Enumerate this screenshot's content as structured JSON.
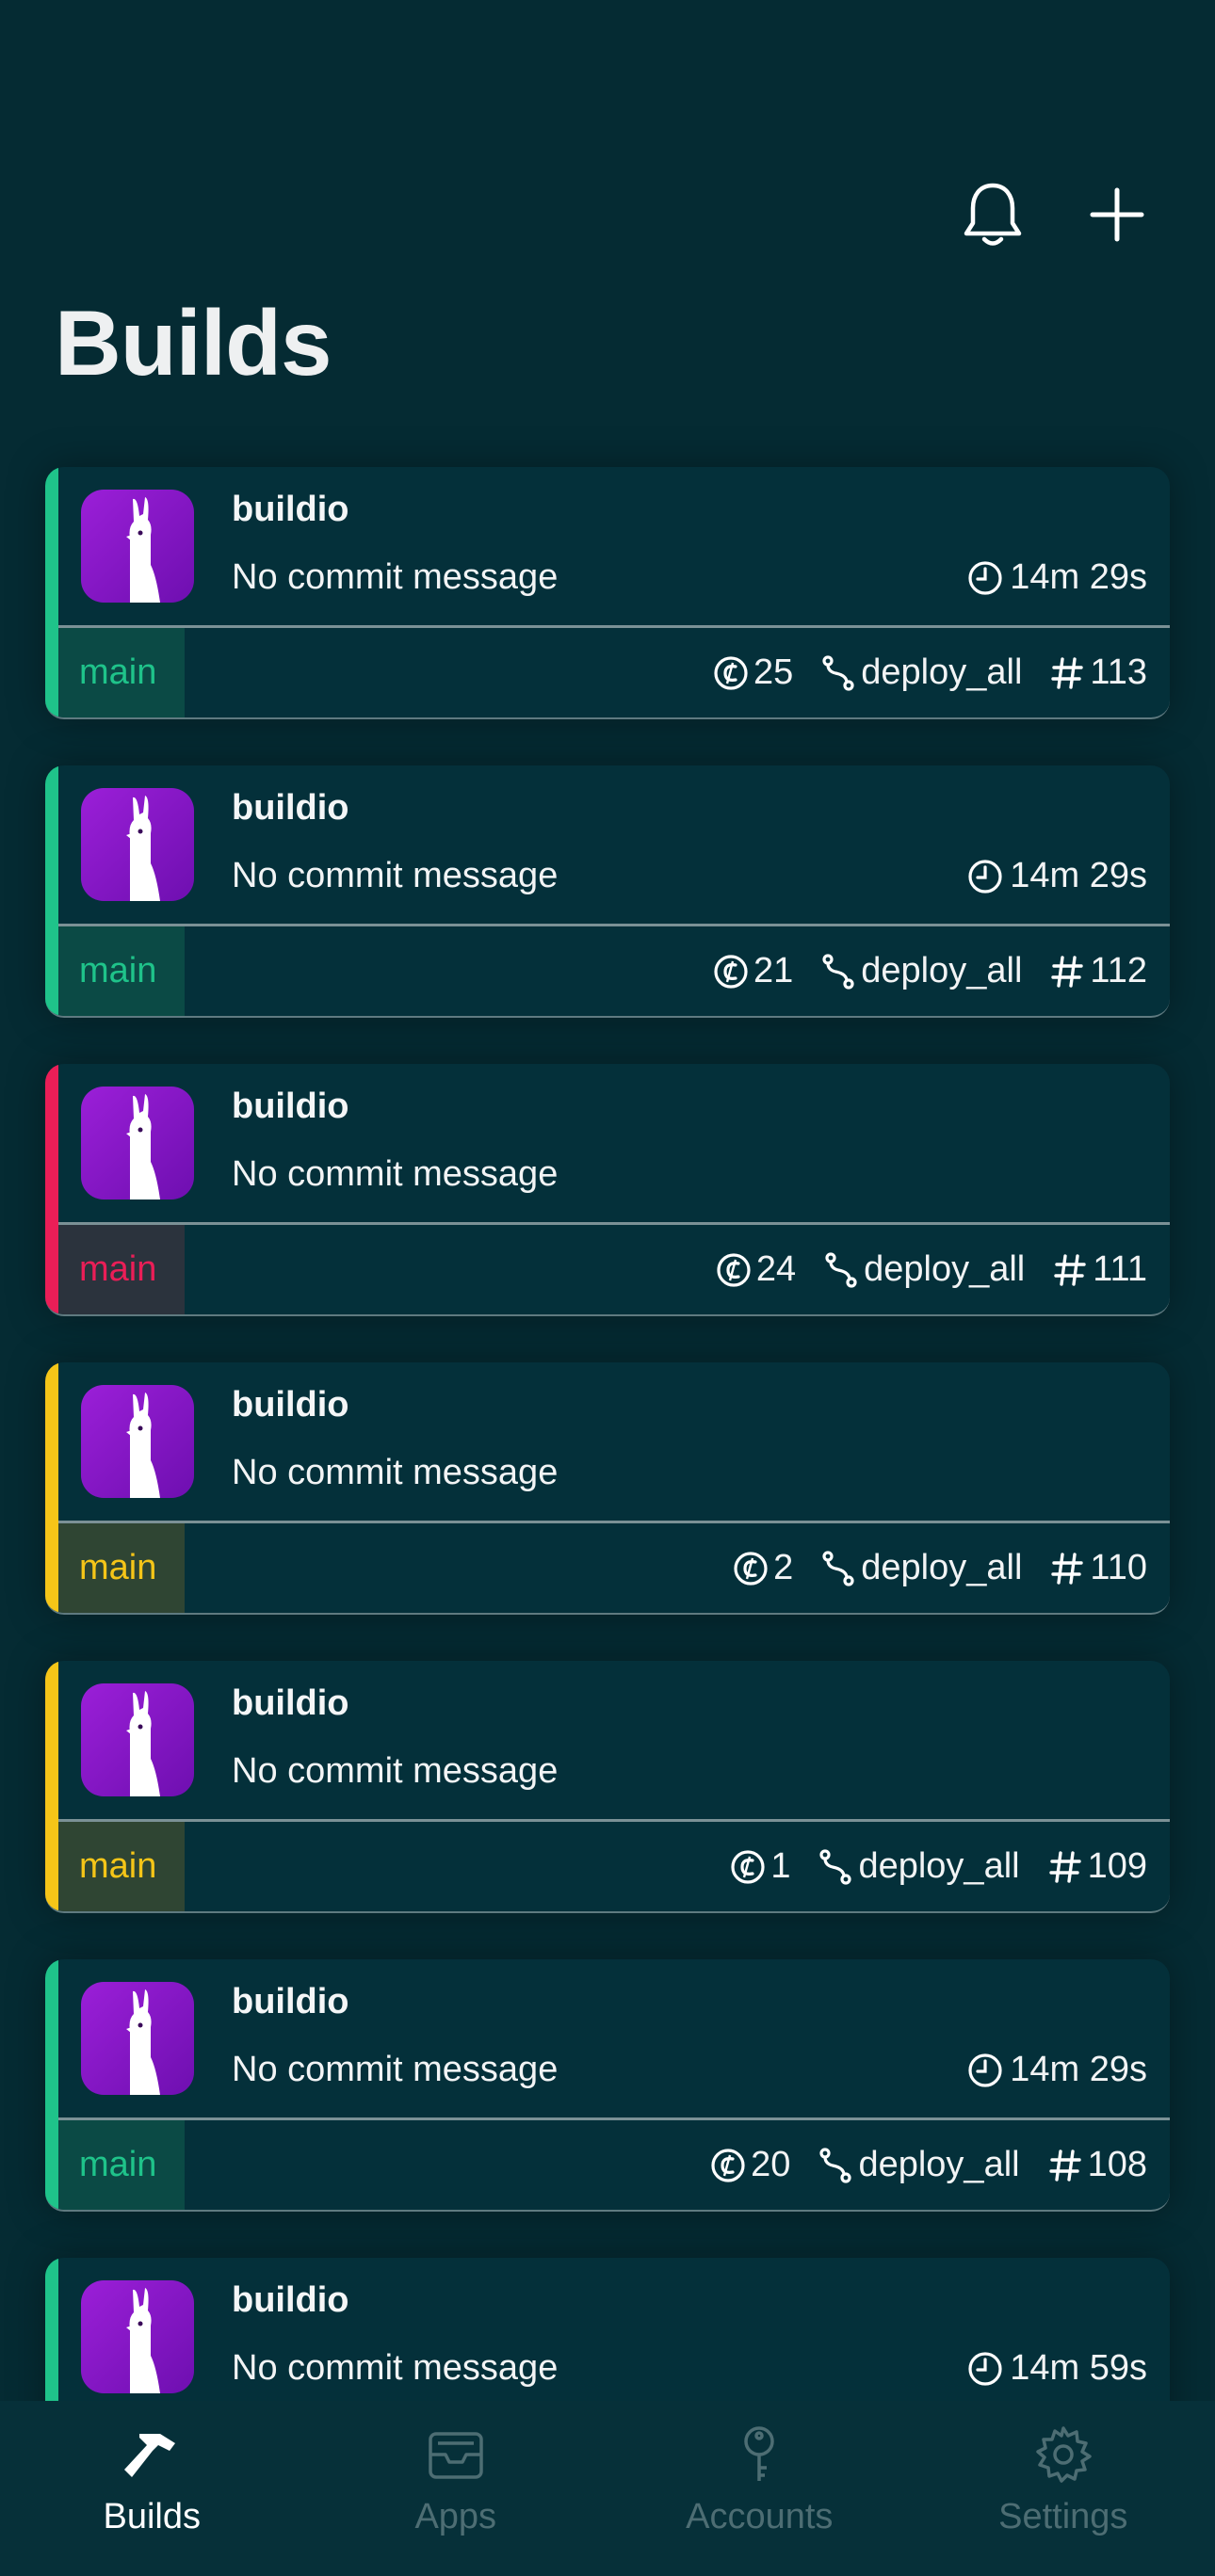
{
  "header": {
    "title": "Builds",
    "notification_icon": "bell-icon",
    "add_icon": "plus-icon"
  },
  "colors": {
    "success": "#1fc38a",
    "failed": "#ea1e57",
    "pending": "#f5c518",
    "background": "#052b33",
    "card": "#04303a"
  },
  "builds": [
    {
      "app": "buildio",
      "commit": "No commit message",
      "duration": "14m 29s",
      "branch": "main",
      "status": "success",
      "credits": "25",
      "workflow": "deploy_all",
      "number": "113"
    },
    {
      "app": "buildio",
      "commit": "No commit message",
      "duration": "14m 29s",
      "branch": "main",
      "status": "success",
      "credits": "21",
      "workflow": "deploy_all",
      "number": "112"
    },
    {
      "app": "buildio",
      "commit": "No commit message",
      "duration": "",
      "branch": "main",
      "status": "failed",
      "credits": "24",
      "workflow": "deploy_all",
      "number": "111"
    },
    {
      "app": "buildio",
      "commit": "No commit message",
      "duration": "",
      "branch": "main",
      "status": "pending",
      "credits": "2",
      "workflow": "deploy_all",
      "number": "110"
    },
    {
      "app": "buildio",
      "commit": "No commit message",
      "duration": "",
      "branch": "main",
      "status": "pending",
      "credits": "1",
      "workflow": "deploy_all",
      "number": "109"
    },
    {
      "app": "buildio",
      "commit": "No commit message",
      "duration": "14m 29s",
      "branch": "main",
      "status": "success",
      "credits": "20",
      "workflow": "deploy_all",
      "number": "108"
    },
    {
      "app": "buildio",
      "commit": "No commit message",
      "duration": "14m 59s",
      "branch": "main",
      "status": "success",
      "credits": "",
      "workflow": "",
      "number": ""
    }
  ],
  "tabs": [
    {
      "label": "Builds",
      "icon": "hammer-icon",
      "active": true
    },
    {
      "label": "Apps",
      "icon": "inbox-icon",
      "active": false
    },
    {
      "label": "Accounts",
      "icon": "key-icon",
      "active": false
    },
    {
      "label": "Settings",
      "icon": "gear-icon",
      "active": false
    }
  ]
}
